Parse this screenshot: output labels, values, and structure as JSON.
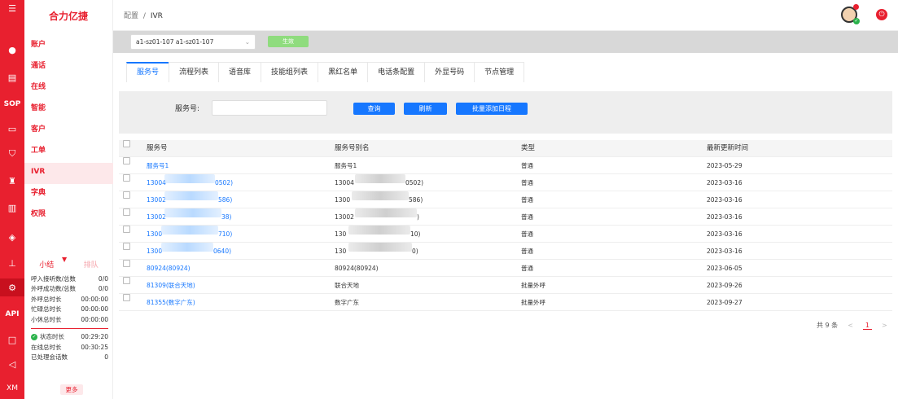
{
  "rail": {
    "icons": [
      "menu-icon",
      "user-icon",
      "clipboard-icon",
      "sop-icon",
      "monitor-icon",
      "shield-icon",
      "robot-icon",
      "bar-chart-icon",
      "chat-icon",
      "org-chart-icon",
      "gear-icon",
      "api-icon",
      "book-icon",
      "megaphone-icon",
      "xm-icon"
    ],
    "sop_label": "SOP",
    "api_label": "API",
    "xm_label": "XM"
  },
  "brand": "合力亿捷",
  "menu": [
    {
      "label": "账户"
    },
    {
      "label": "通话"
    },
    {
      "label": "在线"
    },
    {
      "label": "智能"
    },
    {
      "label": "客户"
    },
    {
      "label": "工单"
    },
    {
      "label": "IVR",
      "active": true
    },
    {
      "label": "字典"
    },
    {
      "label": "权限"
    }
  ],
  "stats": {
    "tab_summary": "小结",
    "tab_queue": "排队",
    "rows_top": [
      {
        "label": "呼入接听数/总数",
        "value": "0/0"
      },
      {
        "label": "外呼成功数/总数",
        "value": "0/0"
      },
      {
        "label": "外呼总时长",
        "value": "00:00:00"
      },
      {
        "label": "忙碌总时长",
        "value": "00:00:00"
      },
      {
        "label": "小休总时长",
        "value": "00:00:00"
      }
    ],
    "status_label": "状态时长",
    "status_value": "00:29:20",
    "online_label": "在线总时长",
    "online_value": "00:30:25",
    "handled_label": "已处理会话数",
    "handled_value": "0",
    "more": "更多"
  },
  "header": {
    "breadcrumb_parent": "配置",
    "breadcrumb_sep": "/",
    "breadcrumb_current": "IVR"
  },
  "selector": {
    "value": "a1-sz01-107 a1-sz01-107",
    "apply_label": "生效"
  },
  "tabs": [
    "服务号",
    "流程列表",
    "语音库",
    "技能组列表",
    "黑红名单",
    "电话条配置",
    "外显号码",
    "节点管理"
  ],
  "search": {
    "label": "服务号:",
    "value": "",
    "query_btn": "查询",
    "refresh_btn": "刷新",
    "batch_btn": "批量添加日程"
  },
  "table": {
    "headers": [
      "服务号",
      "服务号别名",
      "类型",
      "最新更新时间"
    ],
    "rows": [
      {
        "number": "服务号1",
        "alias": "服务号1",
        "type": "普通",
        "updated": "2023-05-29"
      },
      {
        "number": "13004",
        "number_tail": "0502)",
        "alias": "13004",
        "alias_tail": "0502)",
        "type": "普通",
        "updated": "2023-03-16"
      },
      {
        "number": "13002",
        "number_tail": "586)",
        "alias": "1300",
        "alias_tail": "586)",
        "type": "普通",
        "updated": "2023-03-16"
      },
      {
        "number": "13002",
        "number_tail": "38)",
        "alias": "13002",
        "alias_tail": ")",
        "type": "普通",
        "updated": "2023-03-16"
      },
      {
        "number": "1300",
        "number_tail": "710)",
        "alias": "130",
        "alias_tail": "10)",
        "type": "普通",
        "updated": "2023-03-16"
      },
      {
        "number": "1300",
        "number_tail": "0640)",
        "alias": "130",
        "alias_tail": "0)",
        "type": "普通",
        "updated": "2023-03-16"
      },
      {
        "number": "80924(80924)",
        "alias": "80924(80924)",
        "type": "普通",
        "updated": "2023-06-05"
      },
      {
        "number": "81309(联合天地)",
        "alias": "联合天地",
        "type": "批量外呼",
        "updated": "2023-09-26"
      },
      {
        "number": "81355(数字广东)",
        "alias": "数字广东",
        "type": "批量外呼",
        "updated": "2023-09-27"
      }
    ]
  },
  "pagination": {
    "total": "共 9 条",
    "current": "1",
    "prev": "<",
    "next": ">"
  },
  "colors": {
    "brand_red": "#e8202f",
    "primary_blue": "#1677ff",
    "apply_green": "#8fdc7e"
  }
}
